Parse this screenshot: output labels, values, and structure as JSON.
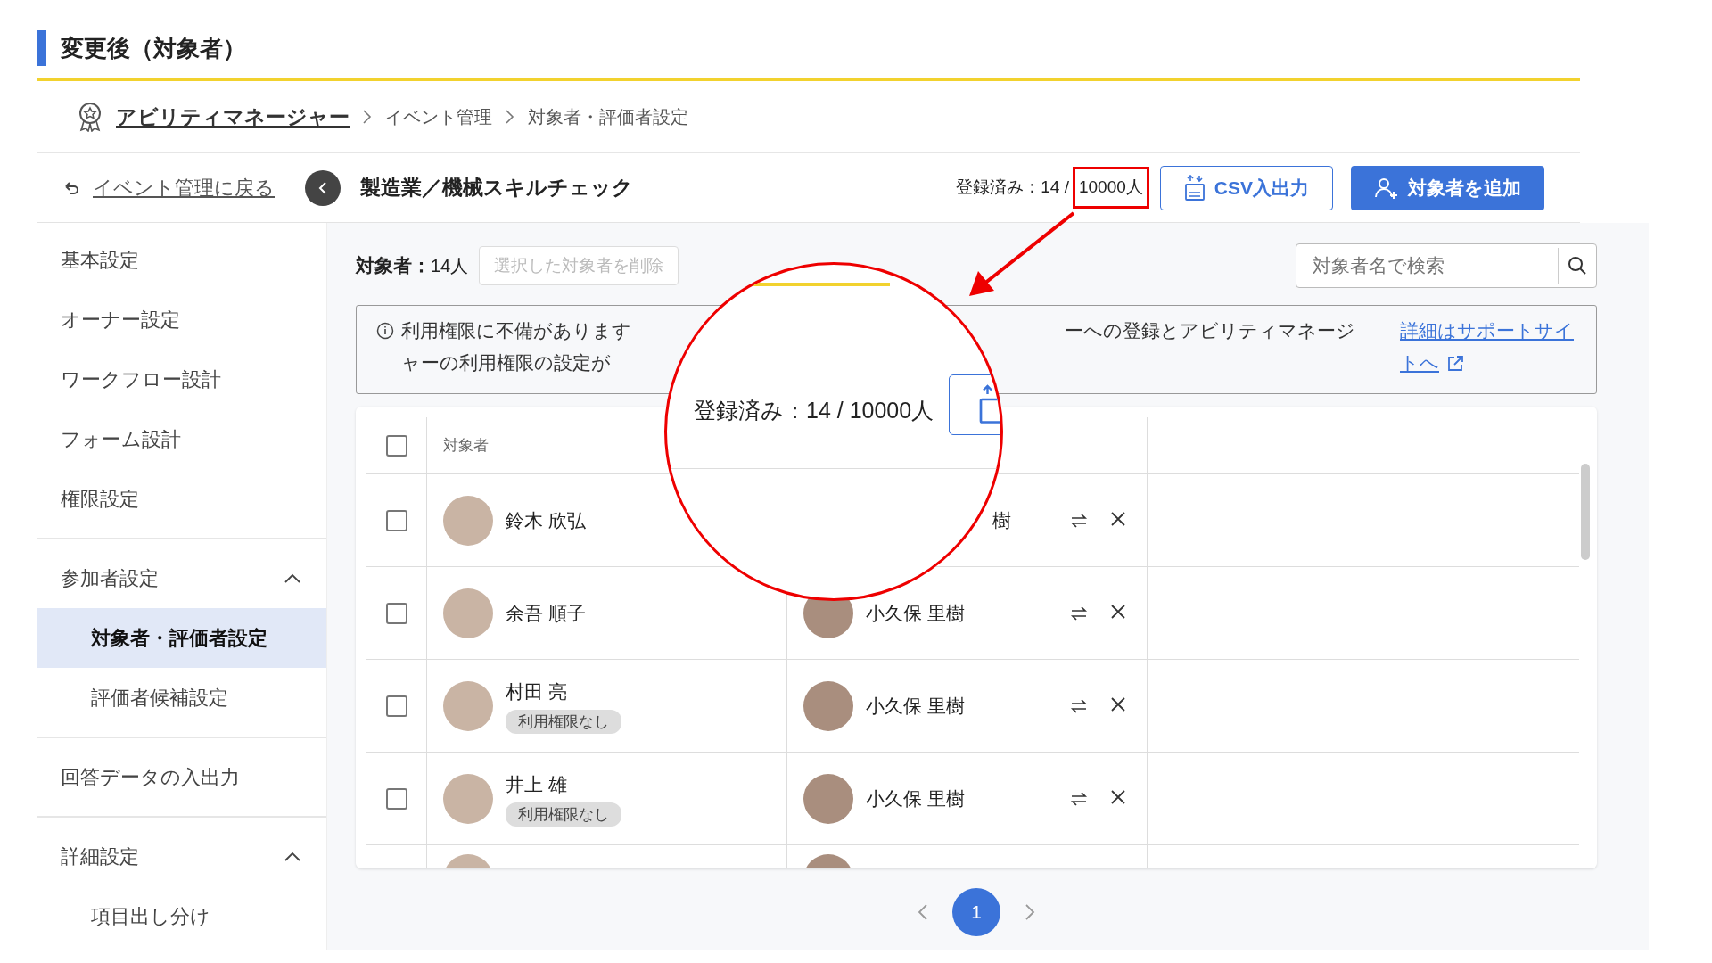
{
  "section_title": "変更後（対象者）",
  "breadcrumb": [
    {
      "label": "アビリティマネージャー",
      "kind": "app"
    },
    {
      "label": "イベント管理",
      "kind": "link"
    },
    {
      "label": "対象者・評価者設定",
      "kind": "current"
    }
  ],
  "back_link": "イベント管理に戻る",
  "event_title": "製造業／機械スキルチェック",
  "registered": {
    "label": "登録済み：14 /",
    "limit": "10000人",
    "highlighted": true
  },
  "header_buttons": [
    {
      "label": "CSV入出力",
      "kind": "outline"
    },
    {
      "label": "対象者を追加",
      "kind": "primary"
    }
  ],
  "sidebar": [
    {
      "label": "基本設定",
      "kind": "item",
      "selected": false
    },
    {
      "label": "オーナー設定",
      "kind": "item",
      "selected": false
    },
    {
      "label": "ワークフロー設計",
      "kind": "item",
      "selected": false
    },
    {
      "label": "フォーム設計",
      "kind": "item",
      "selected": false
    },
    {
      "label": "権限設定",
      "kind": "item",
      "selected": false
    },
    {
      "label": "参加者設定",
      "kind": "group",
      "expanded": true,
      "children": [
        {
          "label": "対象者・評価者設定",
          "selected": true
        },
        {
          "label": "評価者候補設定",
          "selected": false
        }
      ]
    },
    {
      "label": "回答データの入出力",
      "kind": "item",
      "selected": false
    },
    {
      "label": "詳細設定",
      "kind": "group",
      "expanded": true,
      "children": [
        {
          "label": "項目出し分け",
          "selected": false
        }
      ]
    }
  ],
  "toolbar": {
    "count_label": "対象者：",
    "count": "14人",
    "delete_button": {
      "label": "選択した対象者を削除",
      "disabled": true
    },
    "search": {
      "placeholder": "対象者名で検索"
    }
  },
  "notice": {
    "left_lines": [
      "利用権限に不備があります",
      "ャーの利用権限の設定が"
    ],
    "right_line": "ーへの登録とアビリティマネージ",
    "link": "詳細はサポートサイトへ"
  },
  "table": {
    "columns": [
      "対象者"
    ],
    "header_checked": false,
    "rows": [
      {
        "checked": false,
        "name": "鈴木 欣弘",
        "badge": null,
        "evaluator": {
          "name": "樹",
          "kind": "name_only"
        }
      },
      {
        "checked": false,
        "name": "余吾 順子",
        "badge": null,
        "evaluator": {
          "name": "小久保 里樹",
          "kind": "with_avatar"
        }
      },
      {
        "checked": false,
        "name": "村田 亮",
        "badge": "利用権限なし",
        "evaluator": {
          "name": "小久保 里樹",
          "kind": "with_avatar"
        }
      },
      {
        "checked": false,
        "name": "井上 雄",
        "badge": "利用権限なし",
        "evaluator": {
          "name": "小久保 里樹",
          "kind": "with_avatar"
        }
      }
    ]
  },
  "pagination": {
    "pages": [
      {
        "label": "1",
        "selected": true
      }
    ]
  },
  "magnifier": {
    "text": "登録済み：14 / 10000人"
  }
}
